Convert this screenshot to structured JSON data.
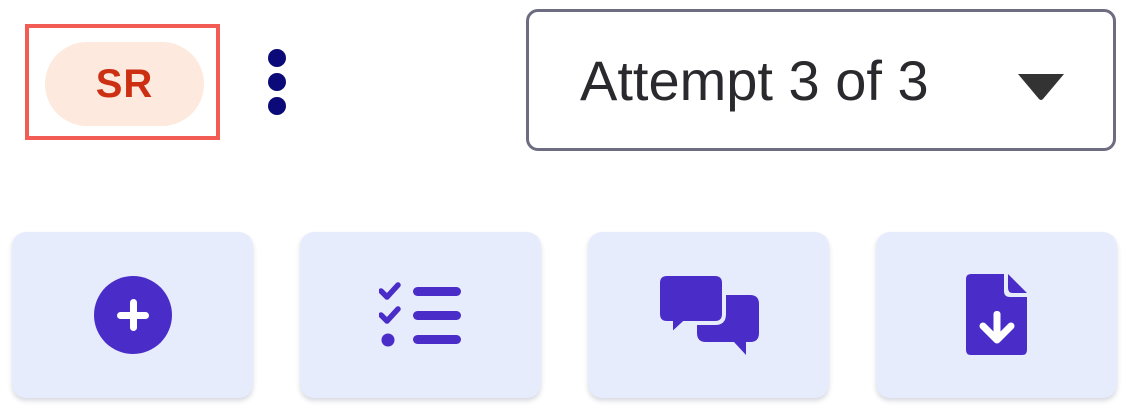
{
  "avatar": {
    "initials": "SR"
  },
  "more_menu": {
    "icon": "vertical-ellipsis-icon"
  },
  "attempt_selector": {
    "selected": "Attempt 3 of 3",
    "icon": "caret-down-icon"
  },
  "action_tiles": [
    {
      "icon": "add-circle-icon"
    },
    {
      "icon": "checklist-icon"
    },
    {
      "icon": "comments-icon"
    },
    {
      "icon": "file-download-icon"
    }
  ],
  "colors": {
    "highlight_border": "#f25c54",
    "avatar_background": "#fde9de",
    "avatar_text": "#cc2f12",
    "menu_dots": "#0c0a78",
    "select_border": "#6e6c80",
    "tile_background": "#e6ecfb",
    "icon_accent": "#4a2cc8"
  }
}
